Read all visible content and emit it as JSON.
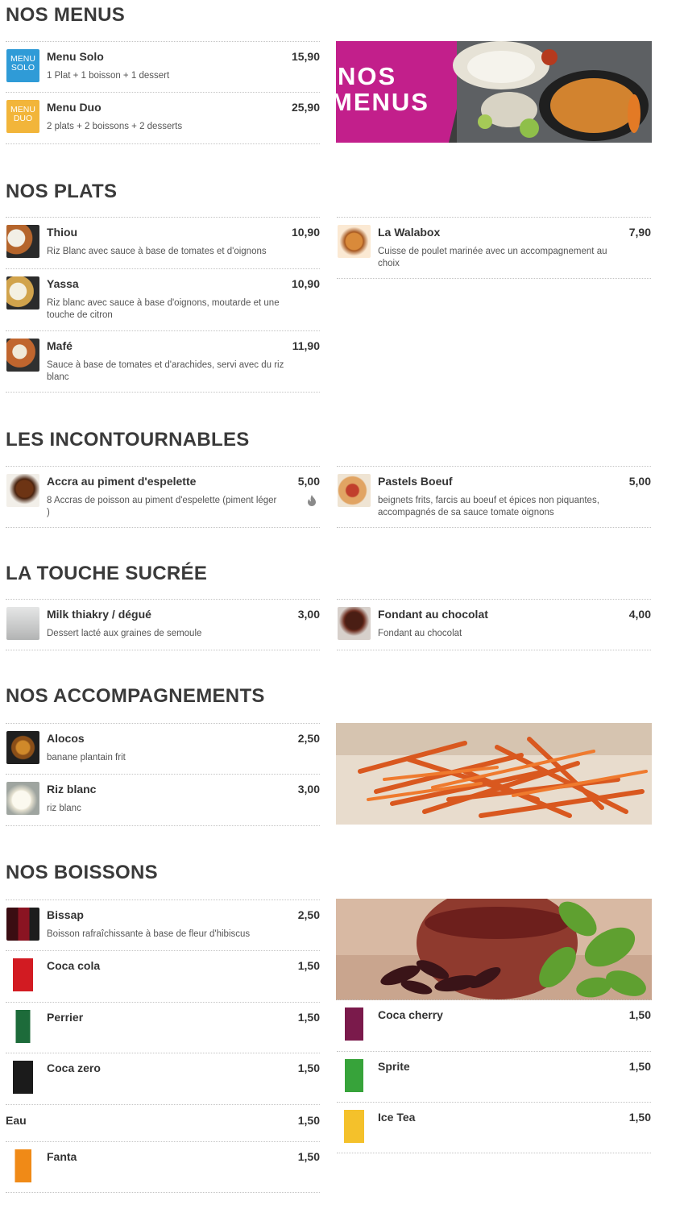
{
  "colors": {
    "title": "#3a3a3a",
    "text": "#333333",
    "muted": "#555555",
    "divider": "#c4c4c4",
    "menus_banner": "#c21f8b",
    "solo_blue": "#2f9bd7",
    "duo_yellow": "#f2b53a"
  },
  "menus": {
    "title": "NOS MENUS",
    "banner_text_1": "NOS",
    "banner_text_2": "MENUS",
    "items": [
      {
        "name": "Menu Solo",
        "price": "15,90",
        "desc": "1 Plat + 1 boisson + 1 dessert",
        "thumb_line1": "MENU",
        "thumb_line2": "SOLO"
      },
      {
        "name": "Menu Duo",
        "price": "25,90",
        "desc": "2 plats + 2 boissons + 2 desserts",
        "thumb_line1": "MENU",
        "thumb_line2": "DUO"
      }
    ]
  },
  "plats": {
    "title": "NOS PLATS",
    "items": [
      {
        "name": "Thiou",
        "price": "10,90",
        "desc": "Riz Blanc avec sauce à base de tomates et d'oignons"
      },
      {
        "name": "Yassa",
        "price": "10,90",
        "desc": "Riz blanc avec sauce à base d'oignons, moutarde et une touche de citron"
      },
      {
        "name": "Mafé",
        "price": "11,90",
        "desc": "Sauce à base de tomates et d'arachides, servi avec du riz blanc"
      },
      {
        "name": "La Walabox",
        "price": "7,90",
        "desc": "Cuisse de poulet marinée avec un accompagnement au choix"
      }
    ]
  },
  "incontournables": {
    "title": "LES INCONTOURNABLES",
    "items": [
      {
        "name": "Accra au piment d'espelette",
        "price": "5,00",
        "desc": "8 Accras de poisson au piment d'espelette (piment léger )",
        "icon": "flame-icon"
      },
      {
        "name": "Pastels Boeuf",
        "price": "5,00",
        "desc": "beignets frits, farcis au boeuf et épices non piquantes, accompagnés de sa sauce tomate oignons"
      }
    ]
  },
  "sucree": {
    "title": "LA TOUCHE SUCRÉE",
    "items": [
      {
        "name": "Milk thiakry / dégué",
        "price": "3,00",
        "desc": "Dessert lacté aux graines de semoule"
      },
      {
        "name": "Fondant au chocolat",
        "price": "4,00",
        "desc": "Fondant au chocolat"
      }
    ]
  },
  "accompagnements": {
    "title": "NOS ACCOMPAGNEMENTS",
    "items": [
      {
        "name": "Alocos",
        "price": "2,50",
        "desc": "banane plantain frit"
      },
      {
        "name": "Riz blanc",
        "price": "3,00",
        "desc": "riz blanc"
      }
    ]
  },
  "boissons": {
    "title": "NOS BOISSONS",
    "items": [
      {
        "name": "Bissap",
        "price": "2,50",
        "desc": "Boisson rafraîchissante à base de fleur d'hibiscus"
      },
      {
        "name": "Coca cola",
        "price": "1,50"
      },
      {
        "name": "Perrier",
        "price": "1,50"
      },
      {
        "name": "Coca zero",
        "price": "1,50"
      },
      {
        "name": "Eau",
        "price": "1,50"
      },
      {
        "name": "Fanta",
        "price": "1,50"
      },
      {
        "name": "Coca cherry",
        "price": "1,50"
      },
      {
        "name": "Sprite",
        "price": "1,50"
      },
      {
        "name": "Ice Tea",
        "price": "1,50"
      }
    ]
  }
}
